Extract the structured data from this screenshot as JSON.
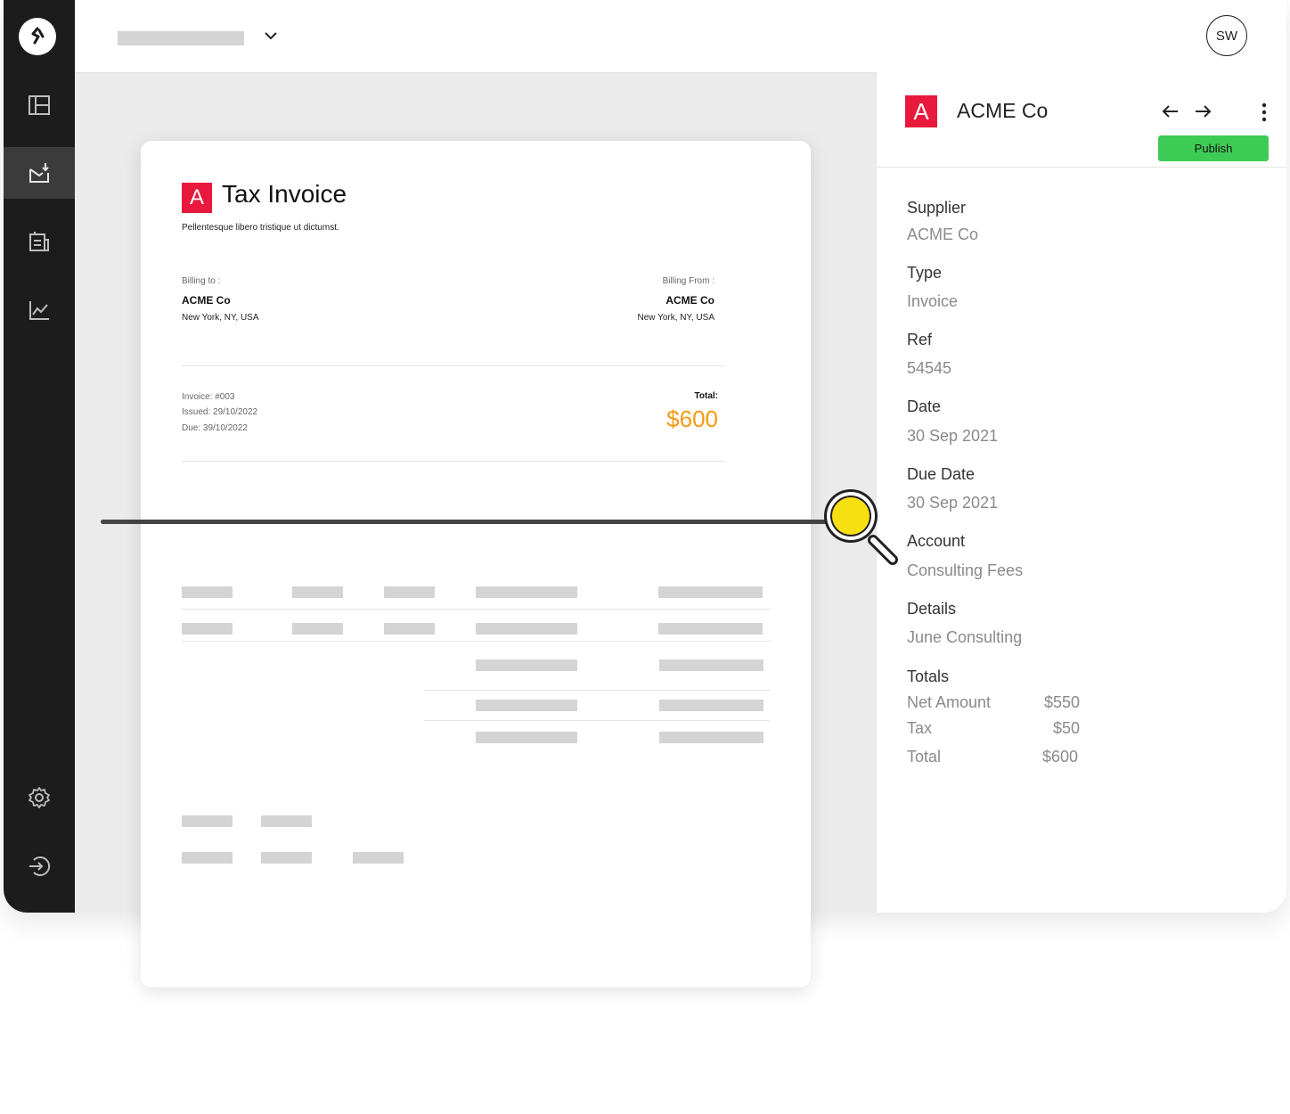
{
  "app": {
    "user_initials": "SW",
    "sidebar": {
      "items": [
        {
          "name": "dashboard-icon"
        },
        {
          "name": "inbox-download-icon",
          "active": true
        },
        {
          "name": "documents-icon"
        },
        {
          "name": "analytics-icon"
        }
      ],
      "bottom": [
        {
          "name": "settings-icon"
        },
        {
          "name": "logout-icon"
        }
      ]
    }
  },
  "invoice": {
    "logo_letter": "A",
    "title": "Tax Invoice",
    "subtitle": "Pellentesque libero tristique ut dictumst.",
    "billing_to": {
      "label": "Billing to :",
      "name": "ACME Co",
      "address": "New York, NY, USA"
    },
    "billing_from": {
      "label": "Billing From :",
      "name": "ACME Co",
      "address": "New York, NY, USA"
    },
    "invoice_no": "Invoice: #003",
    "issued": "Issued: 29/10/2022",
    "due": "Due: 39/10/2022",
    "total_label": "Total:",
    "total_value": "$600",
    "accent_color": "#f39a12",
    "brand_color": "#e8193c"
  },
  "panel": {
    "logo_letter": "A",
    "title": "ACME Co",
    "publish_label": "Publish",
    "publish_color": "#3ecb55",
    "fields": [
      {
        "label": "Supplier",
        "value": "ACME Co"
      },
      {
        "label": "Type",
        "value": "Invoice"
      },
      {
        "label": "Ref",
        "value": "54545"
      },
      {
        "label": "Date",
        "value": "30 Sep 2021"
      },
      {
        "label": "Due Date",
        "value": "30 Sep 2021"
      },
      {
        "label": "Account",
        "value": "Consulting Fees"
      },
      {
        "label": "Details",
        "value": "June Consulting"
      }
    ],
    "totals_label": "Totals",
    "totals": [
      {
        "label": "Net Amount",
        "value": "$550"
      },
      {
        "label": "Tax",
        "value": "$50"
      },
      {
        "label": "Total",
        "value": "$600"
      }
    ]
  }
}
